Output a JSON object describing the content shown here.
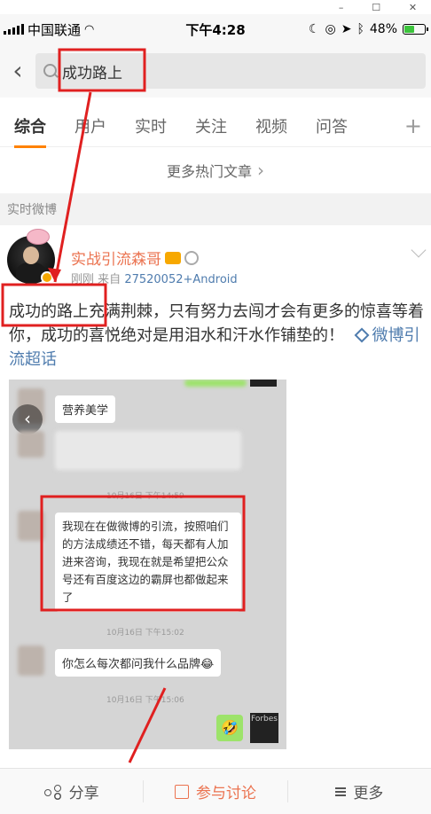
{
  "window_controls": {
    "minimize": "–",
    "maximize": "☐",
    "close": "✕"
  },
  "status_bar": {
    "carrier": "中国联通",
    "time": "下午4:28",
    "battery": "48%",
    "battery_level": 0.48
  },
  "search": {
    "query": "成功路上",
    "back_icon": "chevron-left-icon",
    "icon": "search-icon"
  },
  "tabs": [
    {
      "label": "综合",
      "active": true
    },
    {
      "label": "用户"
    },
    {
      "label": "实时"
    },
    {
      "label": "关注"
    },
    {
      "label": "视频"
    },
    {
      "label": "问答"
    }
  ],
  "tabs_add": "+",
  "more_hot": {
    "label": "更多热门文章",
    "chevron": "›"
  },
  "section_label": "实时微博",
  "post": {
    "author": "实战引流森哥",
    "time": "刚刚",
    "source_prefix": "来自",
    "source": "27520052+Android",
    "text": "成功的路上充满荆棘，只有努力去闯才会有更多的惊喜等着你，成功的喜悦绝对是用泪水和汗水作铺垫的！",
    "topic": "微博引流超话",
    "image": {
      "prev": "‹",
      "group_name": "营养美学",
      "ts1": "10月16日 下午14:59",
      "highlight_msg": "我现在在做微博的引流，按照咱们的方法成绩还不错，每天都有人加进来咨询，我现在就是希望把公众号还有百度这边的霸屏也都做起来了",
      "ts2": "10月16日 下午15:02",
      "msg2": "你怎么每次都问我什么品牌😂",
      "ts3": "10月16日 下午15:06",
      "emoji": "🤣",
      "avatar_text": "Forbes"
    }
  },
  "bottom_bar": {
    "share": "分享",
    "discuss": "参与讨论",
    "more": "更多"
  },
  "colors": {
    "accent": "#ff8200",
    "link": "#4f7cae",
    "author": "#eb7350",
    "annotation": "#e02020"
  }
}
